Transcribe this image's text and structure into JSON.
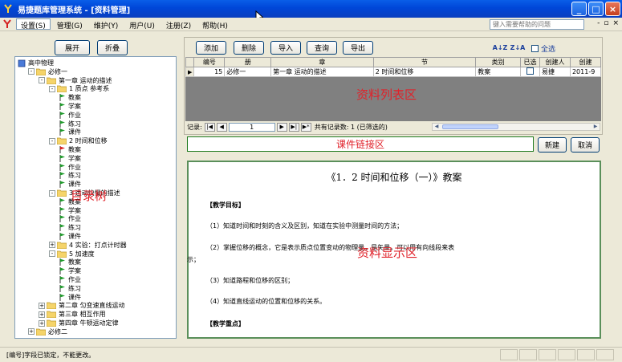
{
  "window": {
    "title": "易捷题库管理系统 - [资料管理]",
    "buttons": [
      "_",
      "□",
      "×"
    ]
  },
  "menu": {
    "items": [
      "设置(S)",
      "管理(G)",
      "维护(Y)",
      "用户(U)",
      "注册(Z)",
      "帮助(H)"
    ],
    "help_search_placeholder": "键入需要帮助的问题",
    "mdi_buttons": [
      "-",
      "▫",
      "×"
    ]
  },
  "left": {
    "expand_label": "展开",
    "collapse_label": "折叠",
    "tree": [
      {
        "label": "高中物理",
        "level": 0,
        "type": "doc",
        "exp": ""
      },
      {
        "label": "必修一",
        "level": 1,
        "type": "folder",
        "exp": "-"
      },
      {
        "label": "第一章 运动的描述",
        "level": 2,
        "type": "folder",
        "exp": "-"
      },
      {
        "label": "1 质点 参考系",
        "level": 3,
        "type": "folder",
        "exp": "-"
      },
      {
        "label": "教案",
        "level": 4,
        "type": "flag"
      },
      {
        "label": "学案",
        "level": 4,
        "type": "flag"
      },
      {
        "label": "作业",
        "level": 4,
        "type": "flag"
      },
      {
        "label": "练习",
        "level": 4,
        "type": "flag"
      },
      {
        "label": "课件",
        "level": 4,
        "type": "flag"
      },
      {
        "label": "2 时间和位移",
        "level": 3,
        "type": "folder",
        "exp": "-"
      },
      {
        "label": "教案",
        "level": 4,
        "type": "flag-red"
      },
      {
        "label": "学案",
        "level": 4,
        "type": "flag"
      },
      {
        "label": "作业",
        "level": 4,
        "type": "flag"
      },
      {
        "label": "练习",
        "level": 4,
        "type": "flag"
      },
      {
        "label": "课件",
        "level": 4,
        "type": "flag"
      },
      {
        "label": "3 运动快慢的描述",
        "level": 3,
        "type": "folder",
        "exp": "-"
      },
      {
        "label": "教案",
        "level": 4,
        "type": "flag"
      },
      {
        "label": "学案",
        "level": 4,
        "type": "flag"
      },
      {
        "label": "作业",
        "level": 4,
        "type": "flag"
      },
      {
        "label": "练习",
        "level": 4,
        "type": "flag"
      },
      {
        "label": "课件",
        "level": 4,
        "type": "flag"
      },
      {
        "label": "4 实验：打点计时器",
        "level": 3,
        "type": "folder",
        "exp": "+"
      },
      {
        "label": "5 加速度",
        "level": 3,
        "type": "folder",
        "exp": "-"
      },
      {
        "label": "教案",
        "level": 4,
        "type": "flag"
      },
      {
        "label": "学案",
        "level": 4,
        "type": "flag"
      },
      {
        "label": "作业",
        "level": 4,
        "type": "flag"
      },
      {
        "label": "练习",
        "level": 4,
        "type": "flag"
      },
      {
        "label": "课件",
        "level": 4,
        "type": "flag"
      },
      {
        "label": "第二章 匀变速直线运动",
        "level": 2,
        "type": "folder",
        "exp": "+"
      },
      {
        "label": "第三章 相互作用",
        "level": 2,
        "type": "folder",
        "exp": "+"
      },
      {
        "label": "第四章 牛顿运动定律",
        "level": 2,
        "type": "folder",
        "exp": "+"
      },
      {
        "label": "必修二",
        "level": 1,
        "type": "folder",
        "exp": "+"
      }
    ],
    "overlay_label": "目录树"
  },
  "toolbar": {
    "buttons": [
      "添加",
      "删除",
      "导入",
      "查询",
      "导出"
    ],
    "sort_asc": "A↓Z",
    "sort_desc": "Z↓A",
    "select_all_label": "全选"
  },
  "grid": {
    "columns": [
      "编号",
      "册",
      "章",
      "节",
      "类别",
      "已选",
      "创建人",
      "创建"
    ],
    "rows": [
      [
        "15",
        "必修一",
        "第一章 运动的描述",
        "2 时间和位移",
        "教案",
        "",
        "易捷",
        "2011-9"
      ]
    ],
    "overlay_label": "资料列表区"
  },
  "navigator": {
    "prefix": "记录:",
    "current": "1",
    "summary": "共有记录数: 1 (已筛选的)"
  },
  "link": {
    "overlay_label": "课件链接区",
    "new_label": "新建",
    "cancel_label": "取消"
  },
  "document": {
    "title": "《1．2 时间和位移（一）》教案",
    "heading1": "【教学目标】",
    "p1": "（1）知道时间和时刻的含义及区别，知道在实验中测量时间的方法；",
    "p2": "（2）掌握位移的概念，它是表示质点位置变动的物理量，是矢量，可以用有向线段来表",
    "margin_text": "示；",
    "p3": "（3）知道路程和位移的区别；",
    "p4": "（4）知道直线运动的位置和位移的关系。",
    "heading2": "【教学重点】",
    "overlay_label": "资料显示区"
  },
  "status": {
    "text": "[编号]字段已锁定，不能更改。"
  }
}
